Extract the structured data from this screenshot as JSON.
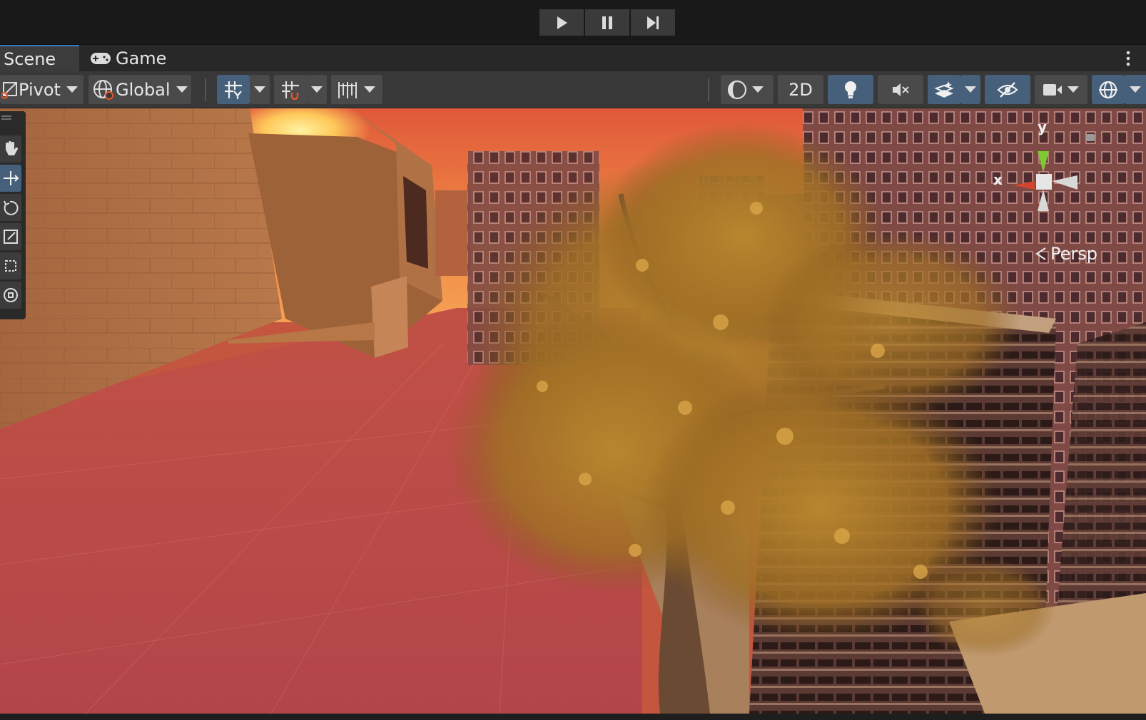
{
  "playbar": {
    "play_icon": "play-icon",
    "pause_icon": "pause-icon",
    "step_icon": "step-icon"
  },
  "tabs": {
    "scene_label": "Scene",
    "game_label": "Game",
    "active": "Scene"
  },
  "toolbar": {
    "pivot_label": "Pivot",
    "global_label": "Global",
    "mode_2d_label": "2D"
  },
  "gizmo": {
    "x_label": "x",
    "y_label": "y",
    "projection_label": "Persp"
  },
  "colors": {
    "accent": "#46607c",
    "tab_highlight": "#3a79bb",
    "gizmo_x": "#d2462e",
    "gizmo_y": "#7ec832"
  }
}
